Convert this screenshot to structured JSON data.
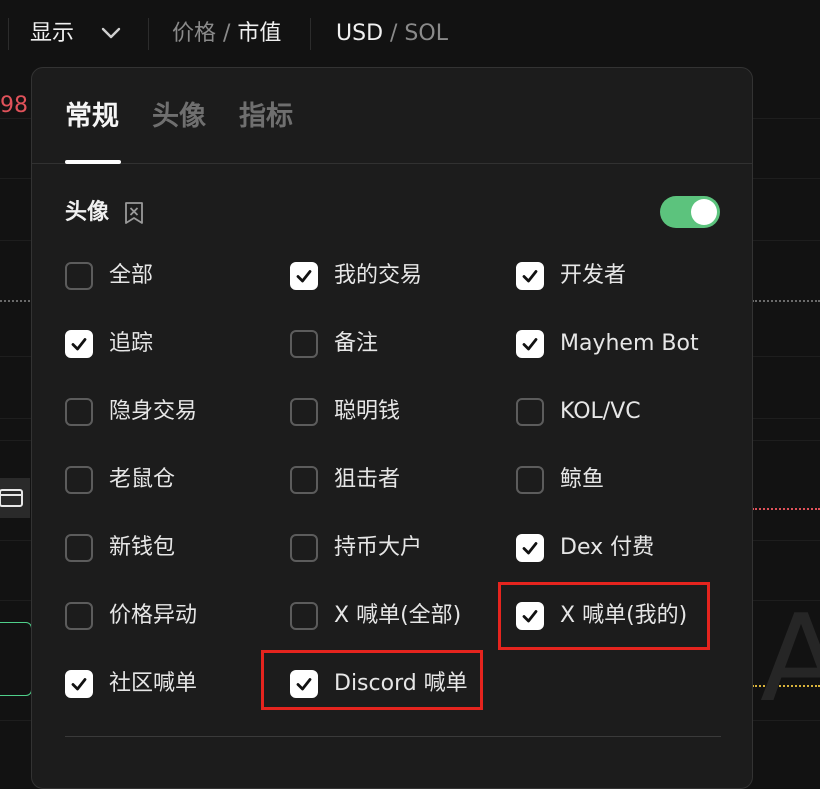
{
  "toolbar": {
    "display_label": "显示",
    "price_label": "价格",
    "slash1": " / ",
    "marketcap_label": "市值",
    "usd_label": "USD",
    "slash2": " / ",
    "sol_label": "SOL"
  },
  "background": {
    "partial_price": "98"
  },
  "panel": {
    "tabs": [
      {
        "label": "常规",
        "active": true
      },
      {
        "label": "头像",
        "active": false
      },
      {
        "label": "指标",
        "active": false
      }
    ],
    "section_title": "头像",
    "section_icon": "bookmark-x-icon",
    "toggle_on": true,
    "options": [
      {
        "label": "全部",
        "checked": false
      },
      {
        "label": "我的交易",
        "checked": true
      },
      {
        "label": "开发者",
        "checked": true
      },
      {
        "label": "追踪",
        "checked": true
      },
      {
        "label": "备注",
        "checked": false
      },
      {
        "label": "Mayhem Bot",
        "checked": true
      },
      {
        "label": "隐身交易",
        "checked": false
      },
      {
        "label": "聪明钱",
        "checked": false
      },
      {
        "label": "KOL/VC",
        "checked": false
      },
      {
        "label": "老鼠仓",
        "checked": false
      },
      {
        "label": "狙击者",
        "checked": false
      },
      {
        "label": "鲸鱼",
        "checked": false
      },
      {
        "label": "新钱包",
        "checked": false
      },
      {
        "label": "持币大户",
        "checked": false
      },
      {
        "label": "Dex 付费",
        "checked": true
      },
      {
        "label": "价格异动",
        "checked": false
      },
      {
        "label": "X 喊单(全部)",
        "checked": false
      },
      {
        "label": "X 喊单(我的)",
        "checked": true
      },
      {
        "label": "社区喊单",
        "checked": true
      },
      {
        "label": "Discord 喊单",
        "checked": true
      }
    ]
  },
  "colors": {
    "accent_toggle": "#5cc37d",
    "highlight": "#e5241e",
    "price_red": "#e0525a"
  }
}
